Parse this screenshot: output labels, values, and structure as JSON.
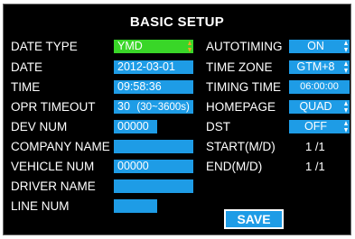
{
  "title": "BASIC SETUP",
  "left": {
    "date_type": {
      "label": "DATE TYPE",
      "value": "YMD"
    },
    "date": {
      "label": "DATE",
      "value": "2012-03-01"
    },
    "time": {
      "label": "TIME",
      "value": "09:58:36"
    },
    "opr_timeout": {
      "label": "OPR TIMEOUT",
      "value": "30",
      "hint": "(30~3600s)"
    },
    "dev_num": {
      "label": "DEV NUM",
      "value": "00000"
    },
    "company_name": {
      "label": "COMPANY NAME",
      "value": ""
    },
    "vehicle_num": {
      "label": "VEHICLE NUM",
      "value": "00000"
    },
    "driver_name": {
      "label": "DRIVER NAME",
      "value": ""
    },
    "line_num": {
      "label": "LINE NUM",
      "value": ""
    }
  },
  "right": {
    "autotiming": {
      "label": "AUTOTIMING",
      "value": "ON"
    },
    "time_zone": {
      "label": "TIME ZONE",
      "value": "GTM+8"
    },
    "timing_time": {
      "label": "TIMING TIME",
      "value": "06:00:00"
    },
    "homepage": {
      "label": "HOMEPAGE",
      "value": "QUAD"
    },
    "dst": {
      "label": "DST",
      "value": "OFF"
    },
    "start": {
      "label": "START(M/D)",
      "value": "1 /1"
    },
    "end": {
      "label": "END(M/D)",
      "value": "1 /1"
    }
  },
  "save_label": "SAVE",
  "colors": {
    "field": "#1e9ce6",
    "selected": "#39d628",
    "background": "#000000",
    "arrow_selected": "#f5a623"
  }
}
